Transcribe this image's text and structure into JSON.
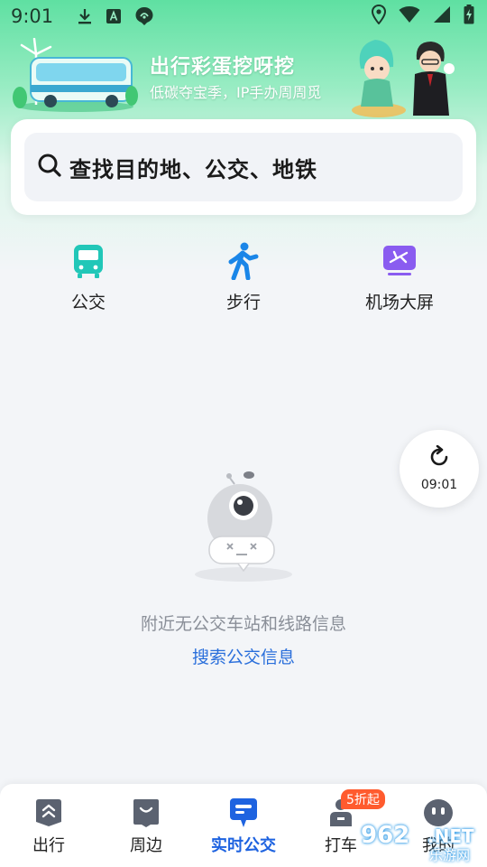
{
  "status_bar": {
    "time": "9:01",
    "left_icons": [
      "download-icon",
      "a-notification-icon",
      "app-notification-icon"
    ],
    "right_icons": [
      "location-icon",
      "wifi-icon",
      "signal-icon",
      "battery-charging-icon"
    ]
  },
  "banner": {
    "title": "出行彩蛋挖呀挖",
    "subtitle": "低碳夺宝季，IP手办周周觅"
  },
  "search": {
    "placeholder": "查找目的地、公交、地铁"
  },
  "quick_entries": [
    {
      "label": "公交",
      "icon": "bus-icon"
    },
    {
      "label": "步行",
      "icon": "walk-icon"
    },
    {
      "label": "机场大屏",
      "icon": "airport-screen-icon"
    }
  ],
  "refresh": {
    "time": "09:01"
  },
  "empty_state": {
    "message": "附近无公交车站和线路信息",
    "link": "搜索公交信息"
  },
  "bottom_nav": {
    "items": [
      {
        "label": "出行",
        "icon": "travel-icon"
      },
      {
        "label": "周边",
        "icon": "nearby-icon"
      },
      {
        "label": "实时公交",
        "icon": "realtime-bus-icon",
        "active": true
      },
      {
        "label": "打车",
        "icon": "taxi-icon",
        "badge": "5折起"
      },
      {
        "label": "我的",
        "icon": "profile-icon"
      }
    ]
  },
  "watermark": {
    "number": "962",
    "suffix": ".NET",
    "text": "乐游网"
  },
  "colors": {
    "accent_blue": "#1e63e0",
    "link_blue": "#2a6fdb",
    "bus_teal": "#21c7b8",
    "walk_blue": "#1a86e8",
    "airport_purple": "#8a5cf0",
    "badge_orange": "#ff5b2e",
    "header_green": "#5fe0a2"
  }
}
